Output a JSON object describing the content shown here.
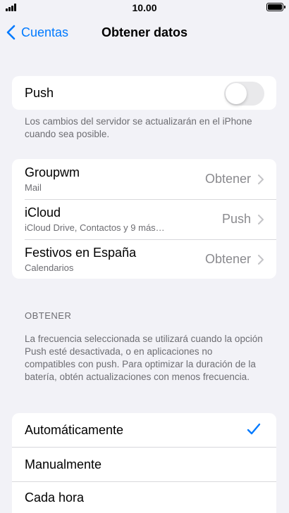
{
  "status_bar": {
    "time": "10.00"
  },
  "nav": {
    "back_label": "Cuentas",
    "title": "Obtener datos"
  },
  "push": {
    "label": "Push",
    "enabled": false,
    "footer": "Los cambios del servidor se actualizarán en el iPhone cuando sea posible."
  },
  "accounts": [
    {
      "name": "Groupwm",
      "detail": "Mail",
      "value": "Obtener"
    },
    {
      "name": "iCloud",
      "detail": "iCloud Drive, Contactos y 9 más…",
      "value": "Push"
    },
    {
      "name": "Festivos en España",
      "detail": "Calendarios",
      "value": "Obtener"
    }
  ],
  "fetch": {
    "header": "OBTENER",
    "footer": "La frecuencia seleccionada se utilizará cuando la opción Push esté desactivada, o en aplicaciones no compatibles con push. Para optimizar la duración de la batería, obtén actualizaciones con menos frecuencia.",
    "options": [
      {
        "label": "Automáticamente",
        "selected": true
      },
      {
        "label": "Manualmente",
        "selected": false
      },
      {
        "label": "Cada hora",
        "selected": false
      }
    ]
  },
  "colors": {
    "accent": "#007aff",
    "background": "#f2f2f7"
  }
}
